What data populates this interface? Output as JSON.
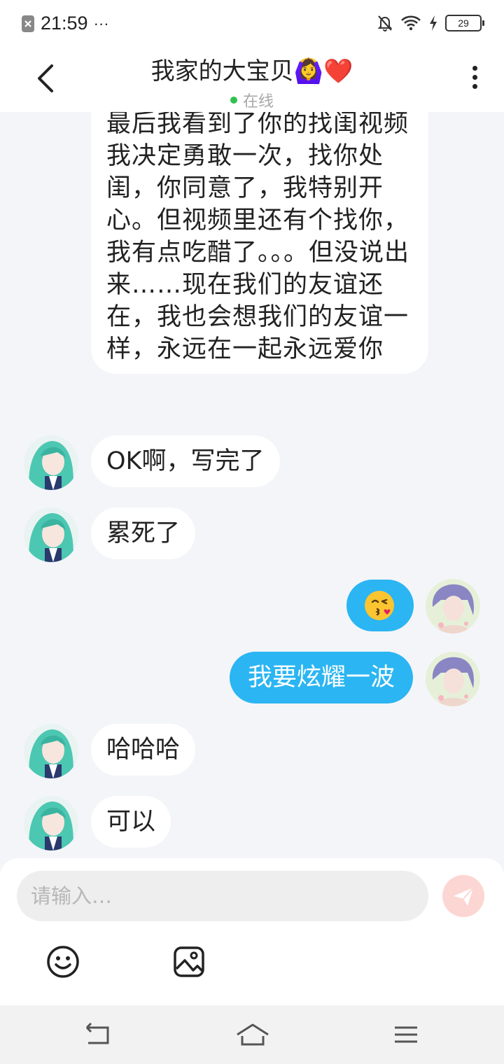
{
  "status_bar": {
    "time": "21:59",
    "dots": "···",
    "battery": "29"
  },
  "header": {
    "title": "我家的大宝贝",
    "title_emoji": "🙆‍♀️❤️",
    "status": "在线"
  },
  "messages": [
    {
      "side": "left",
      "text": "最后我看到了你的找闺视频 我决定勇敢一次，找你处闺，你同意了，我特别开心。但视频里还有个找你，我有点吃醋了。。。但没说出来……现在我们的友谊还在，我也会想我们的友谊一样，永远在一起永远爱你"
    },
    {
      "side": "left",
      "text": "OK啊，写完了"
    },
    {
      "side": "left",
      "text": "累死了"
    },
    {
      "side": "right",
      "text": "😘"
    },
    {
      "side": "right",
      "text": "我要炫耀一波"
    },
    {
      "side": "left",
      "text": "哈哈哈"
    },
    {
      "side": "left",
      "text": "可以"
    }
  ],
  "composer": {
    "placeholder": "请输入…"
  },
  "colors": {
    "sent_bubble": "#2bb5f2",
    "online_dot": "#2fc050",
    "send_button": "#fbd6d2"
  }
}
